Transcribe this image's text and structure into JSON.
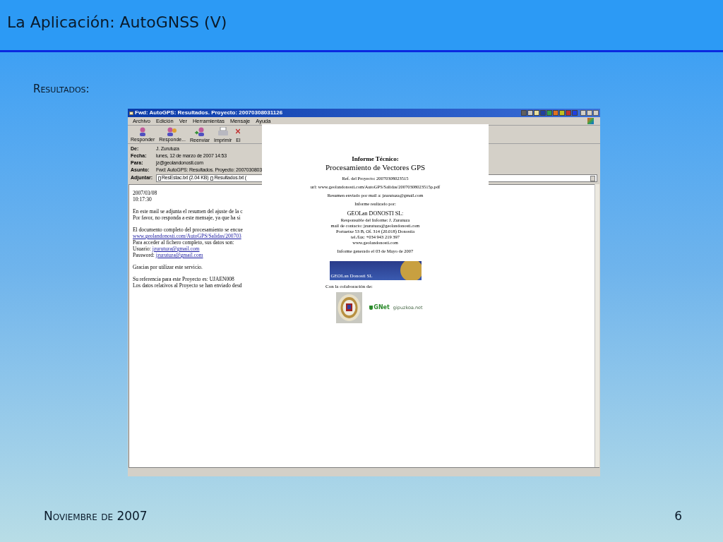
{
  "slide": {
    "title": "La Aplicación: AutoGNSS (V)",
    "subtitle": "Resultados:",
    "footer": "Noviembre de 2007",
    "page_number": "6"
  },
  "window": {
    "title": "Fwd: AutoGPS: Resultados. Proyecto: 20070308031126",
    "menu": [
      "Archivo",
      "Edición",
      "Ver",
      "Herramientas",
      "Mensaje",
      "Ayuda"
    ],
    "toolbar": [
      {
        "label": "Responder",
        "kind": "reply"
      },
      {
        "label": "Responde...",
        "kind": "reply-all"
      },
      {
        "label": "Reenviar",
        "kind": "forward"
      },
      {
        "label": "Imprimir",
        "kind": "print"
      },
      {
        "label": "El",
        "kind": "delete"
      }
    ],
    "headers": [
      {
        "label": "De:",
        "value": "J. Zurutuza"
      },
      {
        "label": "Fecha:",
        "value": "lunes, 12 de marzo de 2007 14:53"
      },
      {
        "label": "Para:",
        "value": "jz@geolandonosti.com"
      },
      {
        "label": "Asunto:",
        "value": "Fwd: AutoGPS: Resultados. Proyecto: 2007030803"
      }
    ],
    "attachments_label": "Adjuntar:",
    "attachments": [
      "ResEstac.txt (2.04 KB)",
      "Resultados.txt ("
    ],
    "body": [
      [
        {
          "kind": "text",
          "text": "2007/03/08"
        },
        {
          "kind": "text",
          "text": "10:17:30"
        }
      ],
      [
        {
          "kind": "text",
          "text": "En este mail se adjunta el resumen del ajuste de la c"
        },
        {
          "kind": "text",
          "text": "Por favor, no responda a este mensaje, ya que ha si"
        }
      ],
      [
        {
          "kind": "text",
          "text": "El documento completo del procesamiento se encue"
        },
        {
          "kind": "link",
          "text": "www.geolandonosti.com/AutoGPS/Salidas/200703"
        },
        {
          "kind": "text",
          "text": "Para acceder al fichero completo, sus datos son:"
        },
        {
          "kind": "field",
          "label": "Usuario:",
          "text": "jzurutuza@gmail.com"
        },
        {
          "kind": "field",
          "label": "Password:",
          "text": "jzurutuza@gmail.com"
        }
      ],
      [
        {
          "kind": "text",
          "text": "Gracias por utilizar este servicio."
        }
      ],
      [
        {
          "kind": "text",
          "text": "Su referencia para este Proyecto es: UJAEN008"
        },
        {
          "kind": "text",
          "text": "Los datos relativos al Proyecto se han enviado desd"
        }
      ]
    ]
  },
  "document": {
    "lines": [
      {
        "kind": "heading",
        "text": "Informe Técnico:"
      },
      {
        "kind": "subheading",
        "text": "Procesamiento de Vectores GPS"
      },
      {
        "kind": "small",
        "text": "Ref. del Proyecto: 20070308023515"
      },
      {
        "kind": "small",
        "text": "url: www.geolandonosti.com/AutoGPS/Salidas/20070308023515p.pdf"
      },
      {
        "kind": "small",
        "text": "Resumen enviado por mail a: jzurutuza@gmail.com"
      },
      {
        "kind": "small",
        "text": "Informe realizado por:"
      },
      {
        "kind": "company",
        "text": "GEOLan DONOSTI SL:"
      },
      {
        "kind": "tight",
        "text": "Responsable del Informe: J. Zurutuza"
      },
      {
        "kind": "tight",
        "text": "mail de contacto: jzurutuza@geolandonosti.com"
      },
      {
        "kind": "tight",
        "text": "Portuetxe 53 B, Of. 314 (20.018) Donostia"
      },
      {
        "kind": "tight",
        "text": "tel./fax: +034 943 219 397"
      },
      {
        "kind": "tight",
        "text": "www.geolandonosti.com"
      },
      {
        "kind": "small",
        "text": "Informe generado el 03 de Mayo de 2007"
      }
    ],
    "banner": "GEOLan Donosti SL",
    "credit": "Con la colaboración de:",
    "partner": {
      "logo": "GNet",
      "site": "gipuzkoa.net"
    }
  }
}
